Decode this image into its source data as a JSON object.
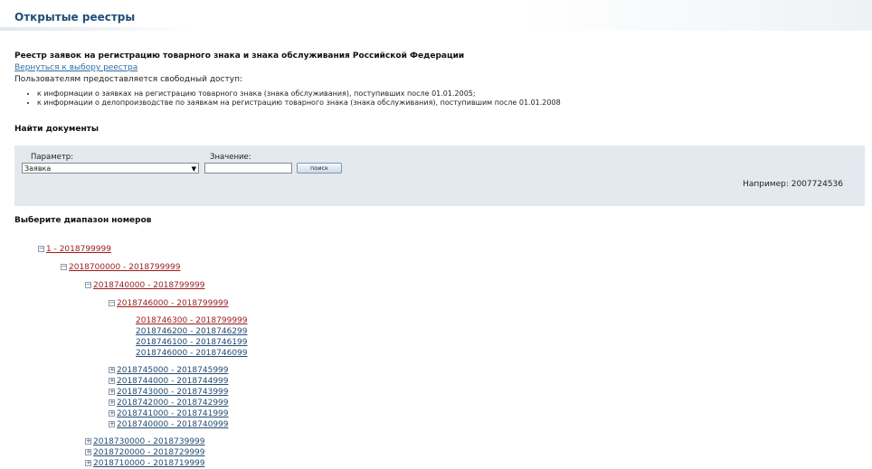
{
  "page": {
    "title": "Открытые реестры",
    "heading": "Реестр заявок на регистрацию товарного знака и знака обслуживания Российской Федерации",
    "back_link": "Вернуться к выбору реестра",
    "intro": "Пользователям предоставляется свободный доступ:",
    "bullets": [
      "к информации о заявках на регистрацию товарного знака (знака обслуживания), поступивших после 01.01.2005;",
      "к информации о делопроизводстве по заявкам на регистрацию товарного знака (знака обслуживания), поступившим после 01.01.2008"
    ]
  },
  "search": {
    "section_title": "Найти документы",
    "param_label": "Параметр:",
    "param_selected": "Заявка",
    "value_label": "Значение:",
    "value": "",
    "button_label": "поиск",
    "example": "Например: 2007724536"
  },
  "ranges": {
    "section_title": "Выберите диапазон номеров",
    "expanded_marker": "⊟",
    "collapsed_marker": "⊞",
    "level1": "1 - 2018799999",
    "level2": "2018700000 - 2018799999",
    "level3": "2018740000 - 2018799999",
    "level4": "2018746000 - 2018799999",
    "leaves": [
      "2018746300 - 2018799999",
      "2018746200 - 2018746299",
      "2018746100 - 2018746199",
      "2018746000 - 2018746099"
    ],
    "level4_siblings": [
      "2018745000 - 2018745999",
      "2018744000 - 2018744999",
      "2018743000 - 2018743999",
      "2018742000 - 2018742999",
      "2018741000 - 2018741999",
      "2018740000 - 2018740999"
    ],
    "level3_siblings": [
      "2018730000 - 2018739999",
      "2018720000 - 2018729999",
      "2018710000 - 2018719999"
    ]
  }
}
